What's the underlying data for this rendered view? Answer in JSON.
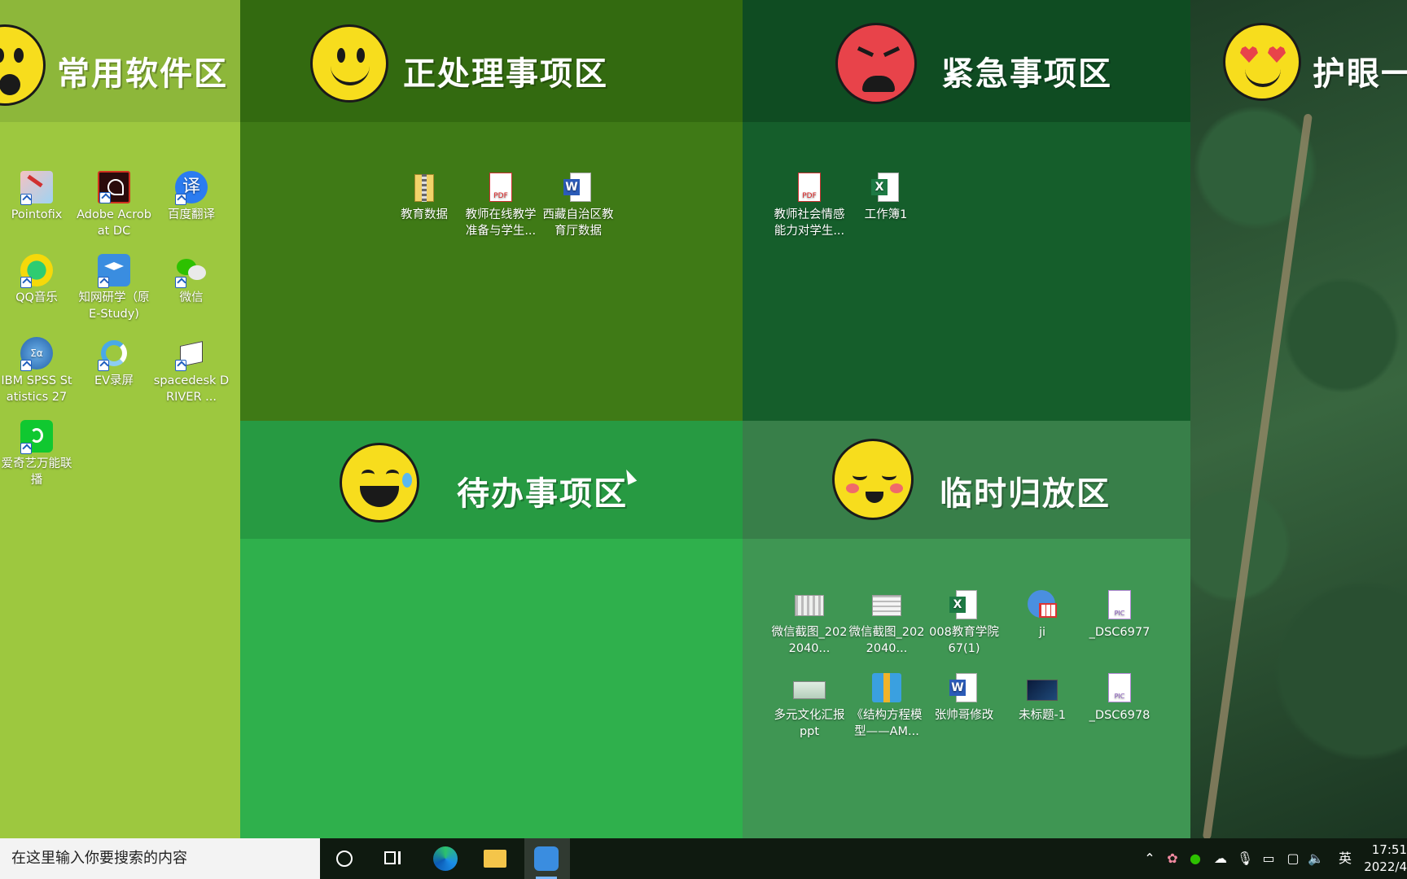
{
  "zones": {
    "software": {
      "title": "常用软件区",
      "bg": "#9dc83f",
      "head_bg": "#8db73a"
    },
    "processing": {
      "title": "正处理事项区",
      "bg": "#3f7a16",
      "head_bg": "#336a10"
    },
    "urgent": {
      "title": "紧急事项区",
      "bg": "#155e2b",
      "head_bg": "#0f4c22"
    },
    "todo": {
      "title": "待办事项区",
      "bg": "#2fb04c",
      "head_bg": "#279a42"
    },
    "temp": {
      "title": "临时归放区",
      "bg": "#3f9653",
      "head_bg": "#387f49"
    },
    "eyecare": {
      "title": "护眼一"
    }
  },
  "icons": {
    "software": [
      {
        "label": "Pointofix",
        "icon": "pointofix-icon"
      },
      {
        "label": "Adobe Acrobat DC",
        "icon": "acrobat-icon"
      },
      {
        "label": "百度翻译",
        "icon": "baidu-translate-icon"
      },
      {
        "label": "QQ音乐",
        "icon": "qq-music-icon"
      },
      {
        "label": "知网研学（原E-Study)",
        "icon": "cnki-icon"
      },
      {
        "label": "微信",
        "icon": "wechat-icon"
      },
      {
        "label": "IBM SPSS Statistics 27",
        "icon": "spss-icon"
      },
      {
        "label": "EV录屏",
        "icon": "ev-recorder-icon"
      },
      {
        "label": "spacedesk DRIVER ...",
        "icon": "spacedesk-icon"
      },
      {
        "label": "爱奇艺万能联播",
        "icon": "iqiyi-icon"
      }
    ],
    "processing": [
      {
        "label": "教育数据",
        "icon": "folder-zip-icon"
      },
      {
        "label": "教师在线教学准备与学生...",
        "icon": "pdf-icon"
      },
      {
        "label": "西藏自治区教育厅数据",
        "icon": "word-icon"
      }
    ],
    "urgent": [
      {
        "label": "教师社会情感能力对学生...",
        "icon": "pdf-icon"
      },
      {
        "label": "工作簿1",
        "icon": "excel-icon"
      }
    ],
    "temp": [
      {
        "label": "微信截图_2022040...",
        "icon": "screenshot-icon"
      },
      {
        "label": "微信截图_2022040...",
        "icon": "screenshot-icon"
      },
      {
        "label": "008教育学院67(1)",
        "icon": "excel-icon"
      },
      {
        "label": "ji",
        "icon": "spreadsheet-app-icon"
      },
      {
        "label": "_DSC6977",
        "icon": "pic-icon"
      },
      {
        "label": "多元文化汇报ppt",
        "icon": "ppt-thumb-icon"
      },
      {
        "label": "《结构方程模型——AM...",
        "icon": "zip-icon"
      },
      {
        "label": "张帅哥修改",
        "icon": "word-icon"
      },
      {
        "label": "未标题-1",
        "icon": "image-thumb-icon"
      },
      {
        "label": "_DSC6978",
        "icon": "pic-icon"
      }
    ]
  },
  "taskbar": {
    "search_placeholder": "在这里输入你要搜索的内容",
    "ime": "英",
    "time": "17:51",
    "date": "2022/4"
  }
}
